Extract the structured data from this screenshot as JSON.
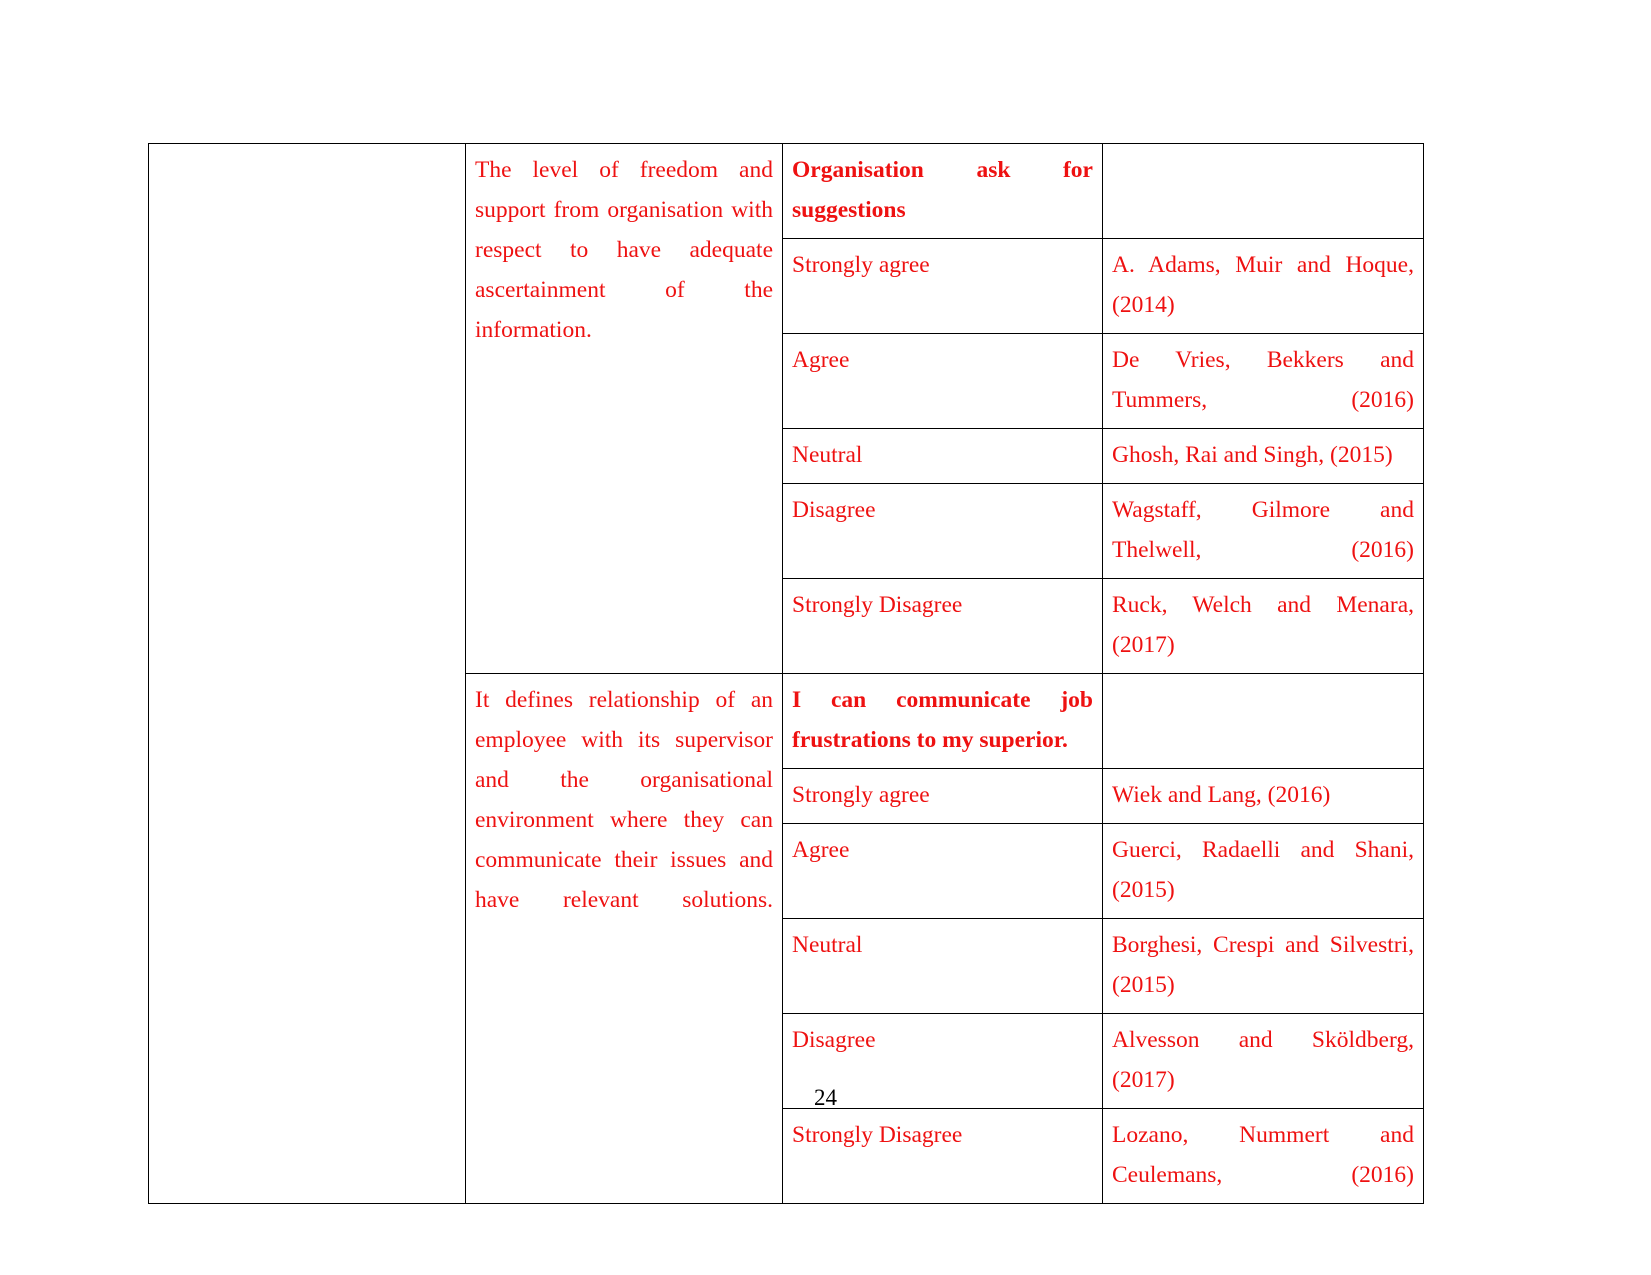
{
  "document": {
    "page_number": "24",
    "text_color": "#ee1111",
    "border_color": "#000000"
  },
  "table": {
    "sections": [
      {
        "empty_cell": "",
        "description": "The level of freedom and support from organisation with respect to have adequate ascertainment of the information.",
        "statement": "Organisation ask for suggestions",
        "statement_trailing": "",
        "rows": [
          {
            "scale": "Strongly agree",
            "author": "A. Adams, Muir and Hoque, (2014)"
          },
          {
            "scale": "Agree",
            "author": "De Vries, Bekkers and Tummers, (2016)"
          },
          {
            "scale": "Neutral",
            "author": "Ghosh, Rai and Singh, (2015)"
          },
          {
            "scale": "Disagree",
            "author": "Wagstaff, Gilmore and Thelwell, (2016)"
          },
          {
            "scale": "Strongly Disagree",
            "author": "Ruck, Welch and Menara, (2017)"
          }
        ]
      },
      {
        "empty_cell": "",
        "description": "It defines relationship of an employee with its supervisor and the organisational environment where they can communicate their issues and have relevant solutions.",
        "statement": "I can communicate job frustrations to my superior",
        "statement_trailing": ".",
        "rows": [
          {
            "scale": "Strongly agree",
            "author": "Wiek and Lang, (2016)"
          },
          {
            "scale": "Agree",
            "author": "Guerci, Radaelli and Shani, (2015)"
          },
          {
            "scale": "Neutral",
            "author": "Borghesi, Crespi and Silvestri, (2015)"
          },
          {
            "scale": "Disagree",
            "author": "Alvesson and Sköldberg, (2017)"
          },
          {
            "scale": "Strongly Disagree",
            "author": "Lozano, Nummert and Ceulemans, (2016)"
          }
        ]
      }
    ]
  }
}
